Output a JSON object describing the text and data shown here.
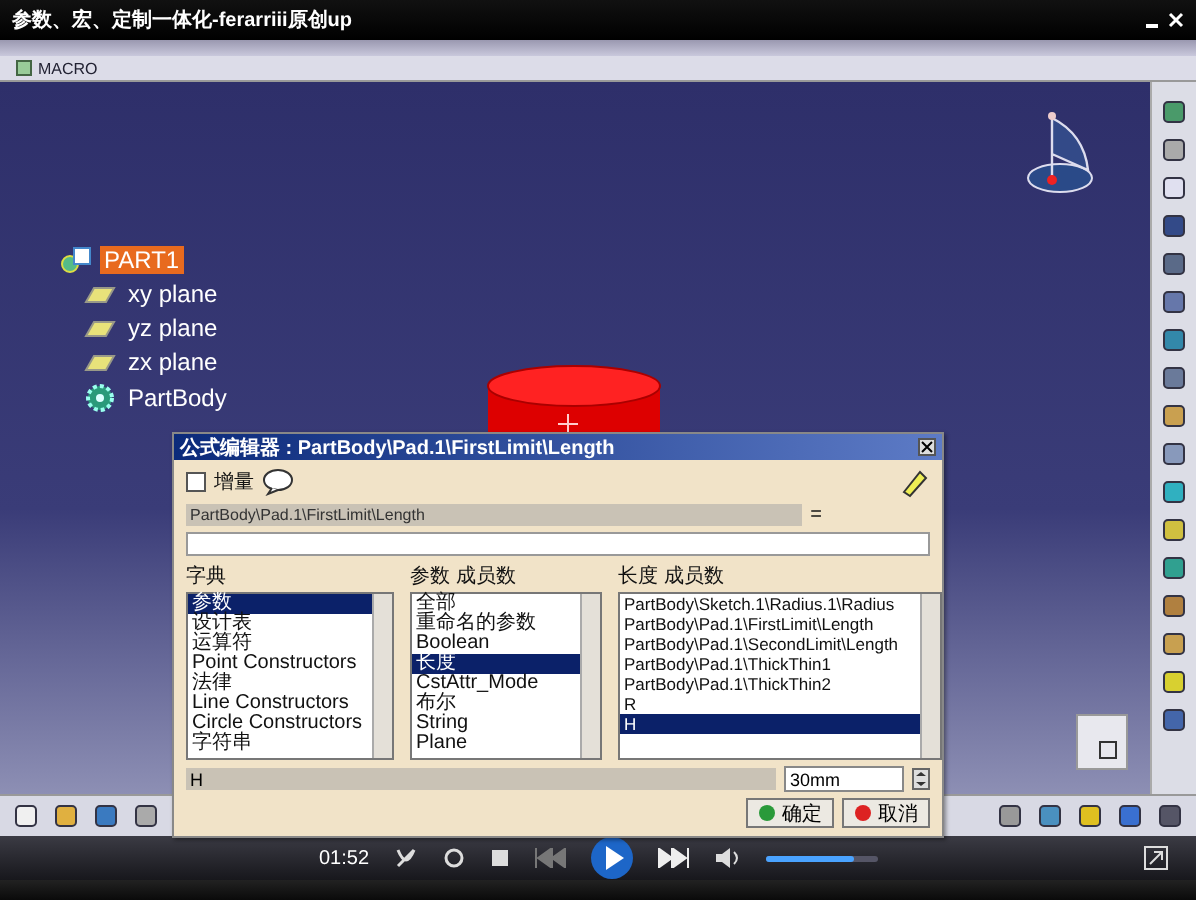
{
  "window": {
    "title": "参数、宏、定制一体化-ferarriii原创up"
  },
  "toolbar": {
    "label": "MACRO"
  },
  "tree": {
    "root": {
      "label": "PART1",
      "selected": true
    },
    "children": [
      {
        "label": "xy plane",
        "kind": "plane"
      },
      {
        "label": "yz plane",
        "kind": "plane"
      },
      {
        "label": "zx plane",
        "kind": "plane"
      },
      {
        "label": "PartBody",
        "kind": "body"
      }
    ]
  },
  "dialog": {
    "title": "公式编辑器 : PartBody\\Pad.1\\FirstLimit\\Length",
    "incremental": {
      "label": "增量",
      "checked": false
    },
    "target": "PartBody\\Pad.1\\FirstLimit\\Length",
    "equals": "=",
    "lists": [
      {
        "header": "字典",
        "items": [
          {
            "label": "参数",
            "selected": true
          },
          {
            "label": "设计表",
            "selected": false
          },
          {
            "label": "运算符",
            "selected": false
          },
          {
            "label": "Point Constructors",
            "selected": false
          },
          {
            "label": "法律",
            "selected": false
          },
          {
            "label": "Line Constructors",
            "selected": false
          },
          {
            "label": "Circle Constructors",
            "selected": false
          },
          {
            "label": "字符串",
            "selected": false
          }
        ]
      },
      {
        "header": "参数 成员数",
        "items": [
          {
            "label": "全部",
            "selected": false
          },
          {
            "label": "重命名的参数",
            "selected": false
          },
          {
            "label": "Boolean",
            "selected": false
          },
          {
            "label": "长度",
            "selected": true
          },
          {
            "label": "CstAttr_Mode",
            "selected": false
          },
          {
            "label": "布尔",
            "selected": false
          },
          {
            "label": "String",
            "selected": false
          },
          {
            "label": "Plane",
            "selected": false
          }
        ]
      },
      {
        "header": "长度 成员数",
        "items": [
          {
            "label": "PartBody\\Sketch.1\\Radius.1\\Radius",
            "selected": false
          },
          {
            "label": "PartBody\\Pad.1\\FirstLimit\\Length",
            "selected": false
          },
          {
            "label": "PartBody\\Pad.1\\SecondLimit\\Length",
            "selected": false
          },
          {
            "label": "PartBody\\Pad.1\\ThickThin1",
            "selected": false
          },
          {
            "label": "PartBody\\Pad.1\\ThickThin2",
            "selected": false
          },
          {
            "label": "R",
            "selected": false
          },
          {
            "label": "H",
            "selected": true
          }
        ]
      }
    ],
    "selected_name": "H",
    "value": "30mm",
    "buttons": [
      {
        "label": "确定",
        "kind": "ok"
      },
      {
        "label": "取消",
        "kind": "cancel"
      }
    ]
  },
  "player": {
    "time": "01:52",
    "volume": {
      "level": 0.8
    }
  }
}
